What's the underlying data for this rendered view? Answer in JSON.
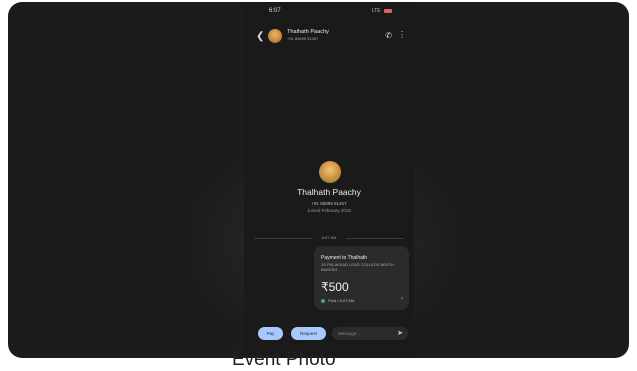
{
  "status_bar": {
    "time": "6:07",
    "indicators": "LTE"
  },
  "header": {
    "back_icon": "arrow-left-icon",
    "contact_name": "Thalhath Paachy",
    "contact_phone": "+91 85899 91457",
    "call_icon": "phone-icon",
    "more_icon": "more-vert-icon"
  },
  "profile": {
    "name": "Thalhath Paachy",
    "phone": "+91 85899 91457",
    "joined": "Joined February 2019"
  },
  "timestamp_divider": "6:07 AM",
  "payment_card": {
    "title": "Payment to Thalhath",
    "note": "JO PALAKKAD LEAD COLLEGE ABUTH BAKESH",
    "amount": "₹500",
    "status": "Paid • 6:07 AM",
    "status_color": "#33b36b"
  },
  "actions": {
    "pay_label": "Pay",
    "request_label": "Request",
    "message_placeholder": "Message...",
    "send_icon": "send-icon"
  },
  "caption": "Event Photo",
  "colors": {
    "background": "#1c1c1e",
    "accent": "#a8c8ff"
  }
}
